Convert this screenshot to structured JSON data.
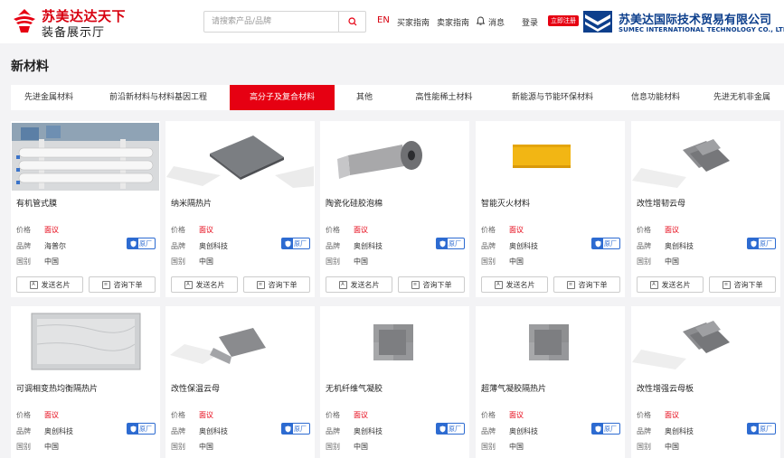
{
  "header": {
    "logo_title": "苏美达达天下",
    "logo_subtitle": "装备展示厅",
    "search_placeholder": "请搜索产品/品牌",
    "lang": "EN",
    "nav_buyer": "买家指南",
    "nav_seller": "卖家指南",
    "nav_message": "消息",
    "nav_login": "登录",
    "register_badge": "立即注册",
    "corp_name_cn": "苏美达国际技术贸易有限公司",
    "corp_name_en": "SUMEC INTERNATIONAL TECHNOLOGY CO., LTD."
  },
  "page_title": "新材料",
  "tabs": [
    {
      "label": "先进金属材料"
    },
    {
      "label": "前沿新材料与材料基因工程"
    },
    {
      "label": "高分子及复合材料",
      "active": true
    },
    {
      "label": "其他"
    },
    {
      "label": "高性能稀土材料"
    },
    {
      "label": "新能源与节能环保材料"
    },
    {
      "label": "信息功能材料"
    },
    {
      "label": "先进无机非金属"
    }
  ],
  "labels": {
    "price": "价格",
    "brand": "品牌",
    "country": "国别",
    "send_card": "发送名片",
    "inquiry": "咨询下单",
    "factory_badge": "原厂"
  },
  "products": [
    {
      "name": "有机管式膜",
      "price": "面议",
      "brand": "海普尔",
      "country": "中国",
      "image": "tube-membrane"
    },
    {
      "name": "纳米隔热片",
      "price": "面议",
      "brand": "奥创科技",
      "country": "中国",
      "image": "gray-sheets"
    },
    {
      "name": "陶瓷化硅胶泡棉",
      "price": "面议",
      "brand": "奥创科技",
      "country": "中国",
      "image": "foam-roll"
    },
    {
      "name": "智能灭火材料",
      "price": "面议",
      "brand": "奥创科技",
      "country": "中国",
      "image": "yellow-strip"
    },
    {
      "name": "改性增韧云母",
      "price": "面议",
      "brand": "奥创科技",
      "country": "中国",
      "image": "mica-sheets"
    },
    {
      "name": "可调相变热均衡隔热片",
      "price": "面议",
      "brand": "奥创科技",
      "country": "中国",
      "image": "silver-panel"
    },
    {
      "name": "改性保温云母",
      "price": "面议",
      "brand": "奥创科技",
      "country": "中国",
      "image": "dark-sheets"
    },
    {
      "name": "无机纤维气凝胶",
      "price": "面议",
      "brand": "奥创科技",
      "country": "中国",
      "image": "aerogel-sheets"
    },
    {
      "name": "超薄气凝胶隔热片",
      "price": "面议",
      "brand": "奥创科技",
      "country": "中国",
      "image": "aerogel-sheets"
    },
    {
      "name": "改性增强云母板",
      "price": "面议",
      "brand": "奥创科技",
      "country": "中国",
      "image": "mica-sheets"
    }
  ],
  "colors": {
    "accent": "#e60012",
    "brand_blue": "#0d3f8c",
    "badge_blue": "#2d6bd1"
  }
}
